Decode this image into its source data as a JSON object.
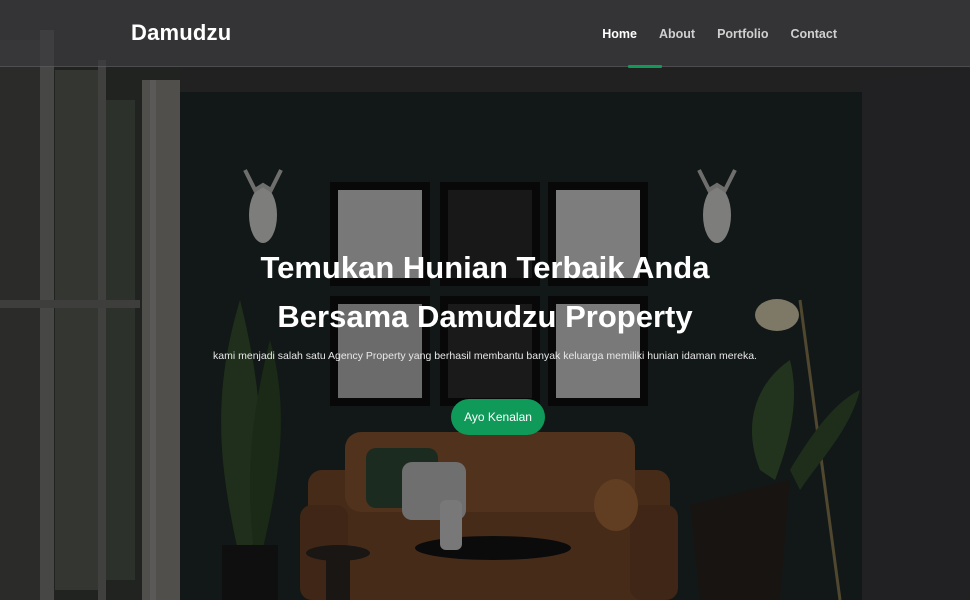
{
  "brand": "Damudzu",
  "nav": {
    "items": [
      {
        "label": "Home",
        "active": true
      },
      {
        "label": "About"
      },
      {
        "label": "Portfolio"
      },
      {
        "label": "Contact"
      }
    ]
  },
  "hero": {
    "title_line1": "Temukan Hunian Terbaik Anda",
    "title_line2": "Bersama Damudzu Property",
    "subtitle": "kami menjadi salah satu Agency Property yang berhasil membantu banyak keluarga memiliki hunian idaman mereka.",
    "cta_label": "Ayo Kenalan"
  },
  "colors": {
    "accent": "#0f9a5a",
    "navbar": "#3c3a3e",
    "wall": "#1f2a28"
  }
}
